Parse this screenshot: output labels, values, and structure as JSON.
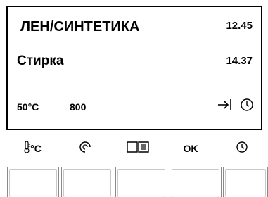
{
  "display": {
    "program": "ЛЕН/СИНТЕТИКА",
    "time_1": "12.45",
    "phase": "Стирка",
    "time_2": "14.37",
    "temperature": "50°C",
    "spin_speed": "800",
    "status_icons": [
      "end-time-arrow-icon",
      "clock-icon"
    ]
  },
  "controls": {
    "labels": [
      {
        "icon": "thermometer-icon",
        "text": "°C"
      },
      {
        "icon": "spin-icon",
        "text": ""
      },
      {
        "icon": "book-icon",
        "text": ""
      },
      {
        "icon": "",
        "text": "OK"
      },
      {
        "icon": "clock-icon",
        "text": ""
      }
    ],
    "buttons": [
      "temperature-button",
      "spin-button",
      "options-button",
      "ok-button",
      "delay-start-button"
    ]
  }
}
